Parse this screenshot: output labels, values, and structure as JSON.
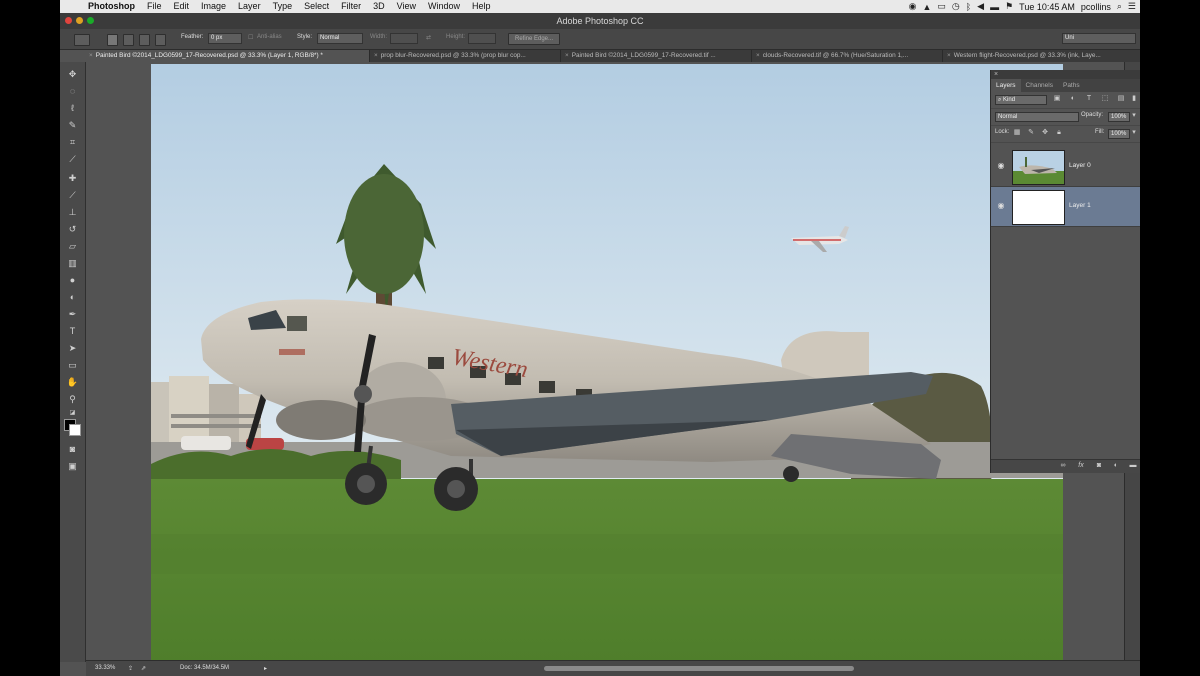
{
  "menubar": {
    "app": "Photoshop",
    "items": [
      "File",
      "Edit",
      "Image",
      "Layer",
      "Type",
      "Select",
      "Filter",
      "3D",
      "View",
      "Window",
      "Help"
    ],
    "clock": "Tue 10:45 AM",
    "user": "pcollins"
  },
  "window": {
    "title": "Adobe Photoshop CC"
  },
  "options": {
    "feather_label": "Feather:",
    "feather_value": "0 px",
    "antialias_label": "Anti-alias",
    "style_label": "Style:",
    "style_value": "Normal",
    "width_label": "Width:",
    "height_label": "Height:",
    "refine_edge": "Refine Edge...",
    "workspace": "Uni"
  },
  "tabs": [
    {
      "label": "Painted Bird ©2014_LDG0599_17-Recovered.psd @ 33.3% (Layer 1, RGB/8*) *",
      "active": true
    },
    {
      "label": "prop blur-Recovered.psd @ 33.3% (prop blur cop...",
      "active": false
    },
    {
      "label": "Painted Bird ©2014_LDG0599_17-Recovered.tif ...",
      "active": false
    },
    {
      "label": "clouds-Recovered.tif @ 66.7% (Hue/Saturation 1,...",
      "active": false
    },
    {
      "label": "Western flight-Recovered.psd @ 33.3% (ink, Laye...",
      "active": false
    }
  ],
  "status": {
    "zoom": "33.33%",
    "doc": "Doc: 34.5M/34.5M"
  },
  "layers_panel": {
    "tabs": [
      "Layers",
      "Channels",
      "Paths"
    ],
    "filter": "Kind",
    "blend_mode": "Normal",
    "opacity_label": "Opacity:",
    "opacity_value": "100%",
    "lock_label": "Lock:",
    "fill_label": "Fill:",
    "fill_value": "100%",
    "layers": [
      {
        "name": "Layer 0",
        "selected": false
      },
      {
        "name": "Layer 1",
        "selected": true
      }
    ],
    "bottom_icons": [
      "link-icon",
      "fx-icon",
      "mask-icon",
      "adjustment-icon",
      "folder-icon"
    ]
  },
  "artwork": {
    "fuselage_text": "Western"
  },
  "colors": {
    "selected_layer": "#6b7b93",
    "sky_top": "#b7d0e4",
    "grass": "#5c8a33"
  }
}
